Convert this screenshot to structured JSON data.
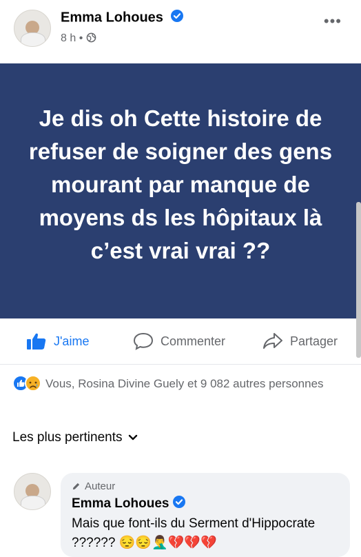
{
  "header": {
    "author_name": "Emma Lohoues",
    "time": "8 h",
    "separator": "•"
  },
  "post": {
    "text": "Je dis oh Cette histoire de refuser de soigner des gens mourant par manque de moyens ds les hôpitaux là c’est vrai vrai ??"
  },
  "actions": {
    "like_label": "J'aime",
    "comment_label": "Commenter",
    "share_label": "Partager"
  },
  "reactions": {
    "summary": "Vous, Rosina Divine Guely et 9 082 autres personnes"
  },
  "comments": {
    "sort_label": "Les plus pertinents",
    "items": [
      {
        "tag": "Auteur",
        "author": "Emma Lohoues",
        "text": "Mais que font-ils du Serment d'Hippocrate ?????? 😔😔🤦‍♂️💔💔💔"
      }
    ]
  },
  "colors": {
    "post_background": "#2b3f70",
    "like_blue": "#1877f2",
    "secondary_text": "#65676b"
  },
  "icons": [
    "more-icon",
    "globe-icon",
    "verified-icon",
    "like-icon",
    "comment-icon",
    "share-icon",
    "like-reaction-icon",
    "sad-reaction-icon",
    "chevron-down-icon",
    "pencil-icon"
  ]
}
